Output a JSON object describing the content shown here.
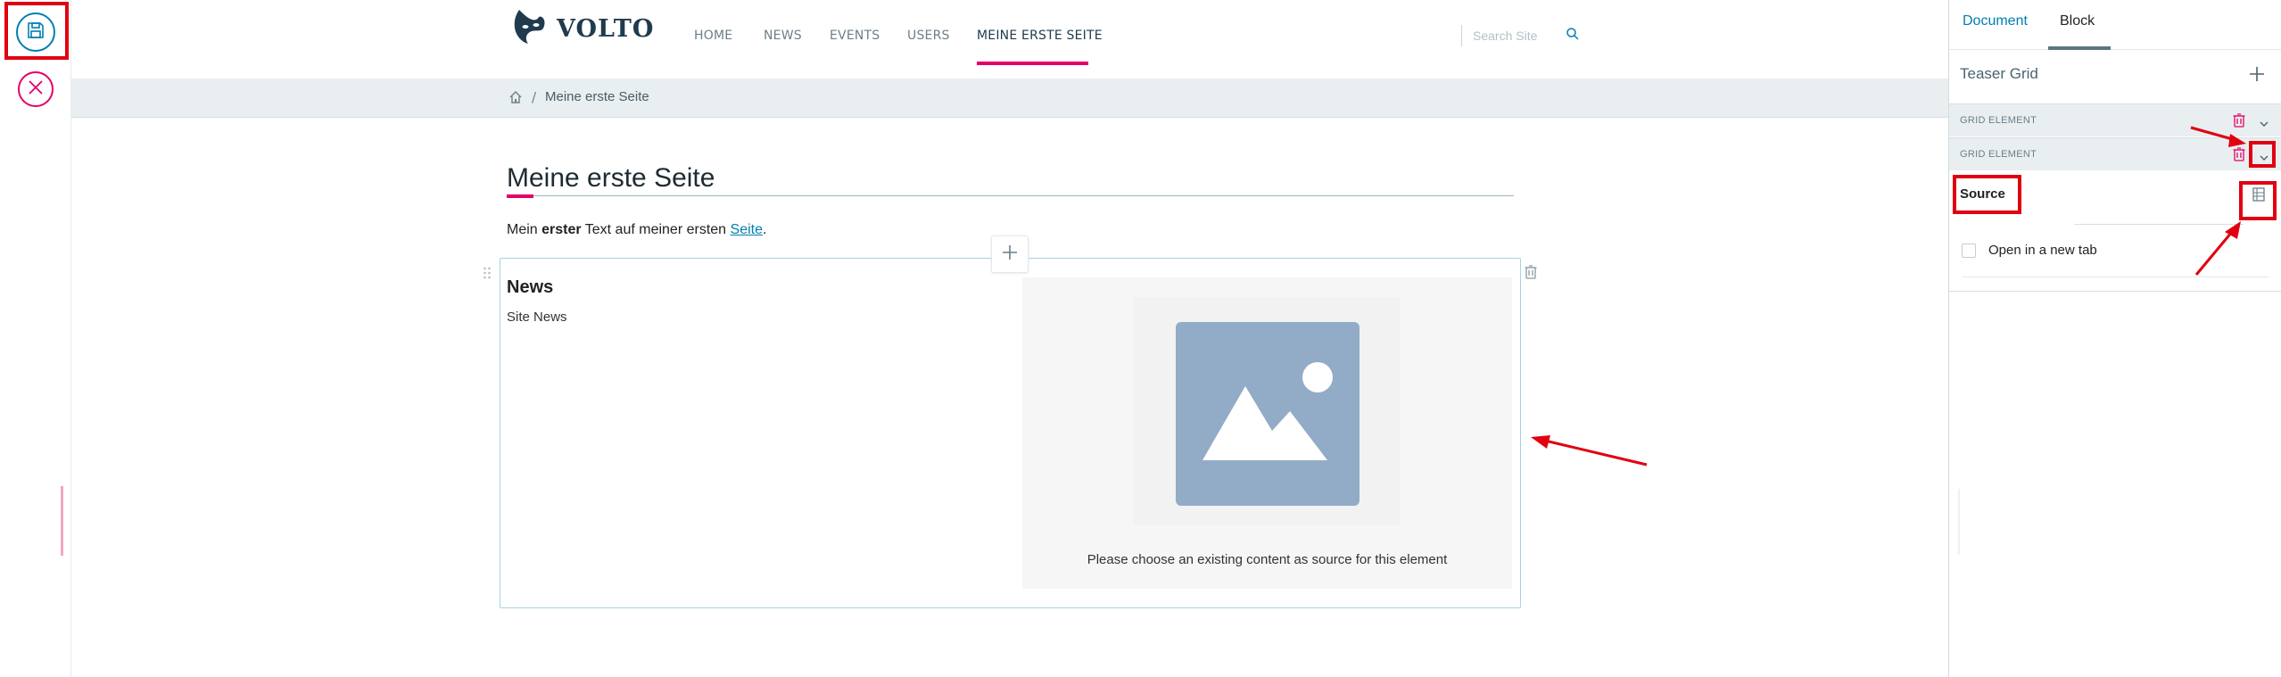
{
  "toolbar": {
    "save_icon": "save-icon",
    "cancel_icon": "close-icon"
  },
  "header": {
    "logo_text": "VOLTO",
    "nav": [
      {
        "label": "HOME"
      },
      {
        "label": "NEWS"
      },
      {
        "label": "EVENTS"
      },
      {
        "label": "USERS"
      },
      {
        "label": "MEINE ERSTE SEITE",
        "active": true
      }
    ],
    "search": {
      "placeholder": "Search Site",
      "value": ""
    }
  },
  "breadcrumb": {
    "home_icon": "home-icon",
    "separator": "/",
    "current": "Meine erste Seite"
  },
  "content": {
    "title": "Meine erste Seite",
    "intro_prefix": "Mein ",
    "intro_bold": "erster",
    "intro_middle": " Text auf meiner ersten ",
    "intro_link": "Seite",
    "intro_suffix": ".",
    "teaser": {
      "title": "News",
      "description": "Site News",
      "placeholder_text": "Please choose an existing content as source for this element"
    }
  },
  "sidebar": {
    "tabs": [
      {
        "label": "Document",
        "active": false
      },
      {
        "label": "Block",
        "active": true
      }
    ],
    "teaser_grid_label": "Teaser Grid",
    "grid_elements": [
      {
        "label": "GRID ELEMENT",
        "expanded": false
      },
      {
        "label": "GRID ELEMENT",
        "expanded": true
      }
    ],
    "source_label": "Source",
    "open_new_tab_label": "Open in a new tab",
    "open_new_tab_checked": false
  },
  "colors": {
    "accent": "#e40166",
    "link": "#007eb1",
    "annotation": "#e00010",
    "placeholder_image": "#92acc7"
  }
}
